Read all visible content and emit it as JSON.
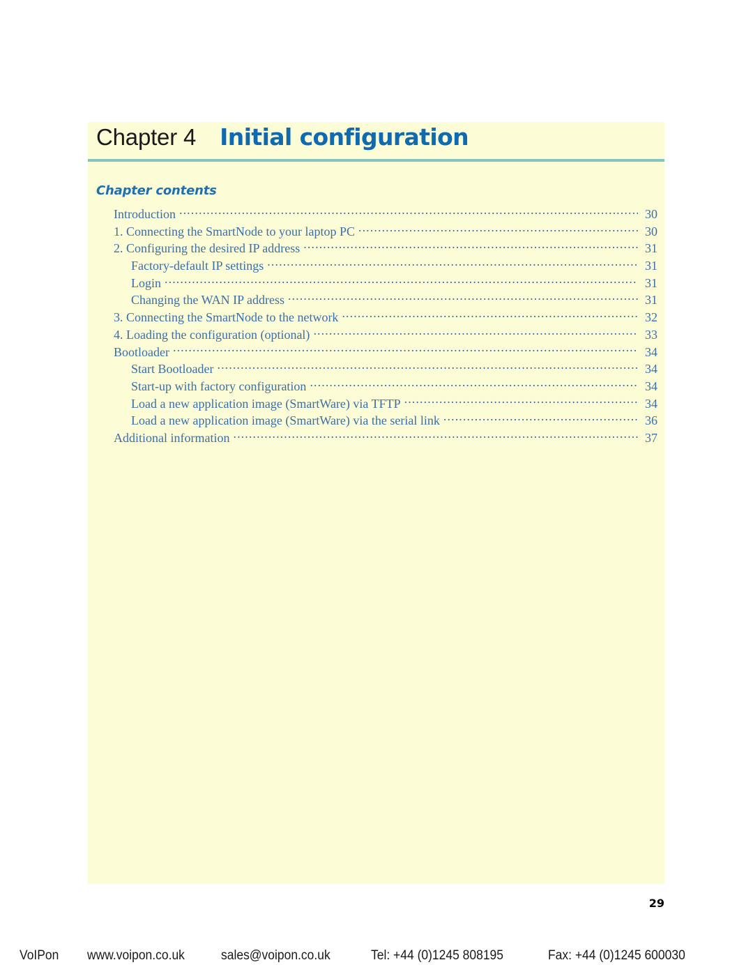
{
  "document": {
    "page_number": "29"
  },
  "header": {
    "chapter_label": "Chapter 4",
    "chapter_title": "Initial configuration"
  },
  "contents": {
    "heading": "Chapter contents",
    "entries": [
      {
        "label": "Introduction",
        "page": "30",
        "level": 1
      },
      {
        "label": "1. Connecting the SmartNode to your laptop PC",
        "page": "30",
        "level": 1
      },
      {
        "label": "2. Configuring the desired IP address",
        "page": "31",
        "level": 1
      },
      {
        "label": "Factory-default IP settings",
        "page": "31",
        "level": 2
      },
      {
        "label": "Login",
        "page": "31",
        "level": 2
      },
      {
        "label": "Changing the WAN IP address",
        "page": "31",
        "level": 2
      },
      {
        "label": "3. Connecting the SmartNode to the network",
        "page": "32",
        "level": 1
      },
      {
        "label": "4. Loading the configuration (optional)",
        "page": "33",
        "level": 1
      },
      {
        "label": "Bootloader",
        "page": "34",
        "level": 1
      },
      {
        "label": "Start Bootloader",
        "page": "34",
        "level": 2
      },
      {
        "label": "Start-up with factory configuration",
        "page": "34",
        "level": 2
      },
      {
        "label": "Load a new application image (SmartWare) via TFTP",
        "page": "34",
        "level": 2
      },
      {
        "label": "Load a new application image (SmartWare) via the serial link",
        "page": "36",
        "level": 2
      },
      {
        "label": "Additional information",
        "page": "37",
        "level": 1
      }
    ]
  },
  "footer": {
    "brand": "VoIPon",
    "website": "www.voipon.co.uk",
    "email": "sales@voipon.co.uk",
    "telephone": "Tel: +44 (0)1245 808195",
    "fax": "Fax: +44 (0)1245 600030"
  },
  "colors": {
    "panel_background": "#fcfcd7",
    "title_blue": "#0f6ab0",
    "heading_blue": "#1f6fb5",
    "toc_blue": "#3a6fa8",
    "rule_teal": "#86c4c0"
  }
}
